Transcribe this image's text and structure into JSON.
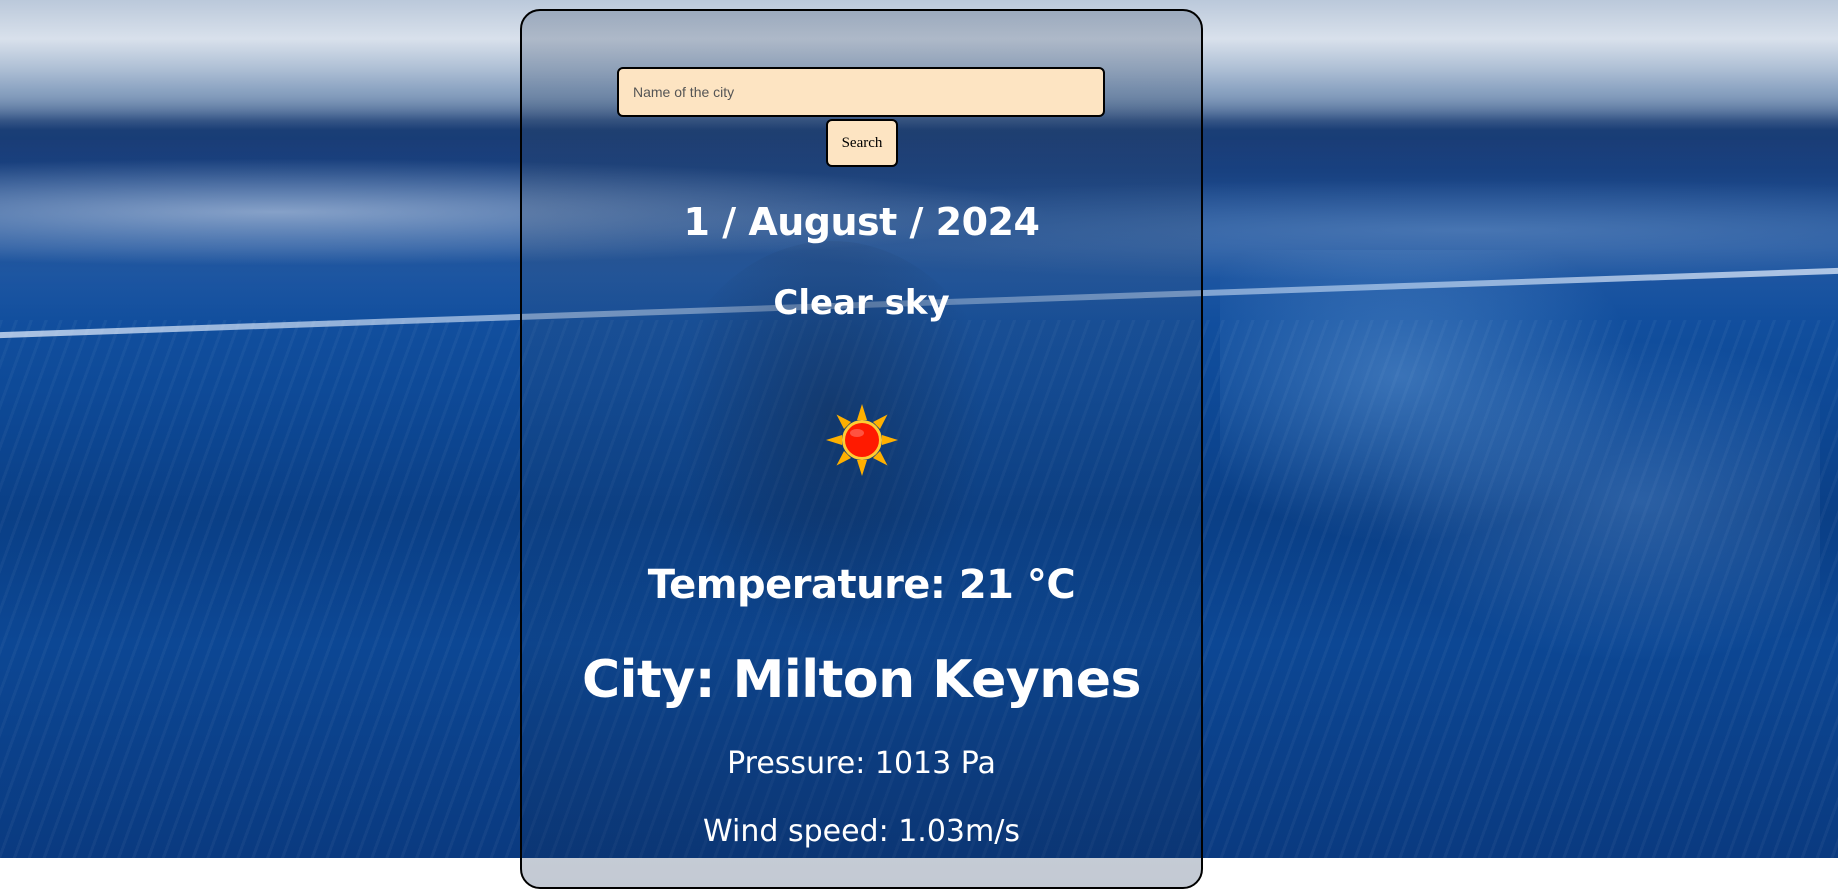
{
  "search": {
    "placeholder": "Name of the city",
    "value": "",
    "button_label": "Search"
  },
  "weather": {
    "date": "1 / August / 2024",
    "description": "Clear sky",
    "icon": "sun-icon",
    "temperature": "Temperature: 21 °C",
    "city": "City: Milton Keynes",
    "pressure": "Pressure: 1013 Pa",
    "wind_speed": "Wind speed: 1.03m/s"
  },
  "colors": {
    "input_background": "#fde4c2",
    "text": "#ffffff",
    "border": "#000000",
    "sun_core": "#ff1a00",
    "sun_rays": "#ffb000"
  }
}
